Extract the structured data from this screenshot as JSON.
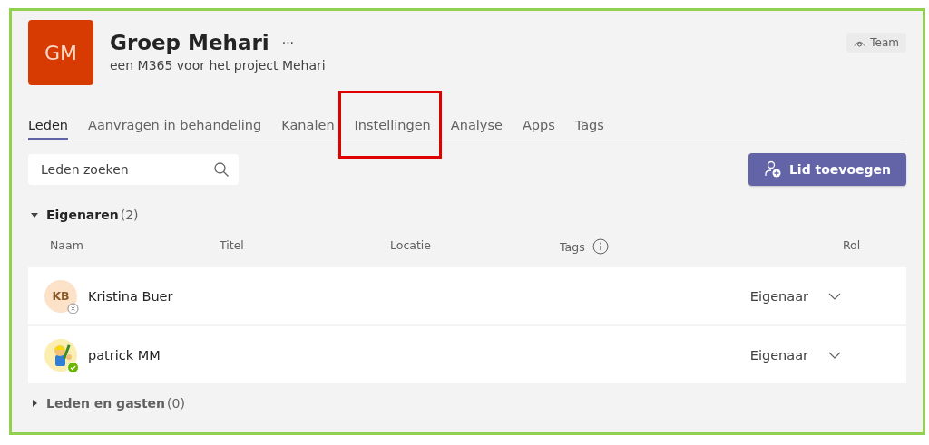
{
  "team": {
    "initials": "GM",
    "name": "Groep Mehari",
    "more": "···",
    "description": "een M365 voor het project Mehari",
    "badge": "Team"
  },
  "tabs": [
    {
      "label": "Leden",
      "selected": true,
      "highlighted": false
    },
    {
      "label": "Aanvragen in behandeling",
      "selected": false,
      "highlighted": false
    },
    {
      "label": "Kanalen",
      "selected": false,
      "highlighted": false
    },
    {
      "label": "Instellingen",
      "selected": false,
      "highlighted": true
    },
    {
      "label": "Analyse",
      "selected": false,
      "highlighted": false
    },
    {
      "label": "Apps",
      "selected": false,
      "highlighted": false
    },
    {
      "label": "Tags",
      "selected": false,
      "highlighted": false
    }
  ],
  "search": {
    "placeholder": "Leden zoeken"
  },
  "add_button": "Lid toevoegen",
  "groups": [
    {
      "title": "Eigenaren",
      "count": "(2)",
      "expanded": true,
      "columns": [
        {
          "label": "Naam",
          "info": false
        },
        {
          "label": "Titel",
          "info": false
        },
        {
          "label": "Locatie",
          "info": false
        },
        {
          "label": "Tags",
          "info": true
        },
        {
          "label": "Rol",
          "info": false
        }
      ],
      "members": [
        {
          "name": "Kristina Buer",
          "avatar": {
            "kind": "initials",
            "initials": "KB"
          },
          "online": false,
          "role": "Eigenaar"
        },
        {
          "name": "patrick MM",
          "online": true,
          "role": "Eigenaar"
        }
      ]
    },
    {
      "title": "Leden en gasten",
      "count": "(0)",
      "expanded": false
    }
  ]
}
